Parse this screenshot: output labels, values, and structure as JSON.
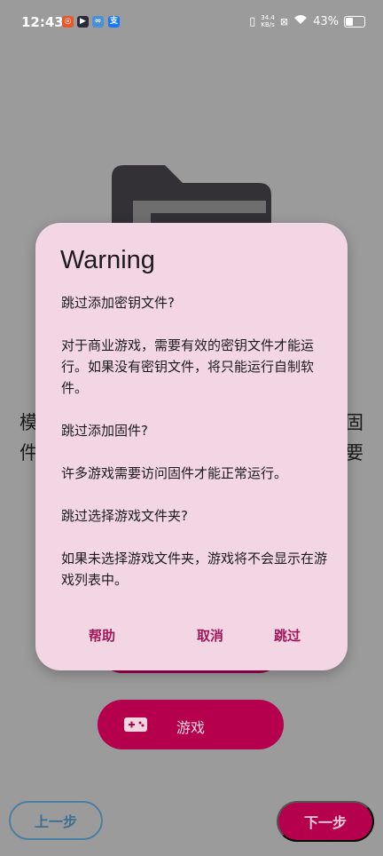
{
  "status_bar": {
    "time": "12:43",
    "net_speed_value": "34.4",
    "net_speed_unit": "KB/s",
    "battery": "43%"
  },
  "background": {
    "left_text_1": "模",
    "left_text_2": "件",
    "right_text_1": "固",
    "right_text_2": "要",
    "games_button_label": "游戏",
    "prev_button_label": "上一步",
    "next_button_label": "下一步"
  },
  "dialog": {
    "title": "Warning",
    "paragraphs": [
      "跳过添加密钥文件?",
      "对于商业游戏，需要有效的密钥文件才能运行。如果没有密钥文件，将只能运行自制软件。",
      "跳过添加固件?",
      "许多游戏需要访问固件才能正常运行。",
      "跳过选择游戏文件夹?",
      "如果未选择游戏文件夹，游戏将不会显示在游戏列表中。"
    ],
    "help_label": "帮助",
    "cancel_label": "取消",
    "skip_label": "跳过"
  },
  "colors": {
    "accent": "#b5004e",
    "dialog_bg": "#f2d6e3",
    "dialog_button_text": "#a0185a",
    "scrim": "#9b9b9b"
  }
}
